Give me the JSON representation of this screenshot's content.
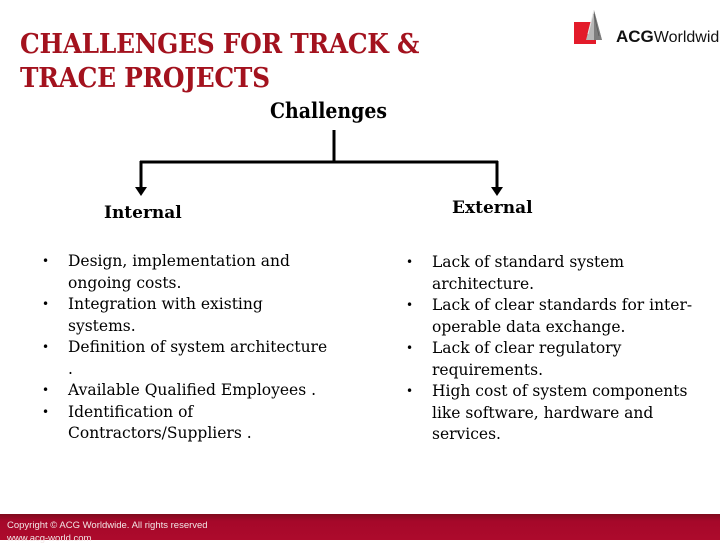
{
  "slide": {
    "title": "CHALLENGES FOR TRACK & TRACE PROJECTS"
  },
  "logo": {
    "brand_bold": "ACG",
    "brand_rest": "Worldwide",
    "icon": "acg-pyramid-logo-icon",
    "colors": {
      "red_square": "#e31b2a",
      "silver_mark": "#9a9a9a"
    }
  },
  "diagram": {
    "root": "Challenges",
    "branches": [
      {
        "label": "Internal",
        "items": [
          "Design, implementation and ongoing costs.",
          "Integration with existing systems.",
          "Definition of system architecture .",
          "Available Qualified Employees .",
          "Identification of Contractors/Suppliers ."
        ]
      },
      {
        "label": "External",
        "items": [
          "Lack of standard system architecture.",
          "Lack of clear standards for inter-operable data exchange.",
          "Lack of clear regulatory requirements.",
          "High cost of system components like software, hardware and services."
        ]
      }
    ]
  },
  "footer": {
    "copyright": "Copyright © ACG Worldwide. All rights reserved",
    "url": "www.acg-world.com"
  },
  "colors": {
    "title": "#a3121e",
    "footer_bar": "#a5082a"
  }
}
